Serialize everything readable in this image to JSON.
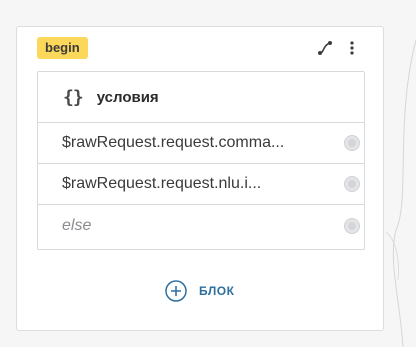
{
  "node": {
    "badge": "begin",
    "block": {
      "title": "условия",
      "rows": [
        {
          "text": "$rawRequest.request.comma..."
        },
        {
          "text": "$rawRequest.request.nlu.i..."
        },
        {
          "text": "else"
        }
      ]
    },
    "add_label": "БЛОК"
  },
  "colors": {
    "badge_bg": "#fcd85a",
    "accent": "#2d6f9e",
    "border": "#d7d9dd"
  },
  "icons": {
    "braces": "{}",
    "path": "path-route-icon",
    "menu": "kebab-menu-icon",
    "add": "plus-circle-icon"
  }
}
